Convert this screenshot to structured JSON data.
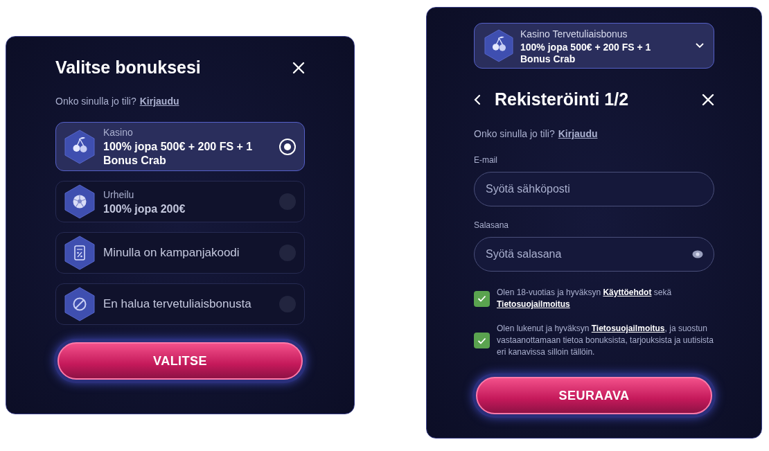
{
  "bonus_picker": {
    "title": "Valitse bonuksesi",
    "login_prompt": "Onko sinulla jo tili?",
    "login_link": "Kirjaudu",
    "options": [
      {
        "kind": "cherry",
        "category": "Kasino",
        "title": "100% jopa 500€ + 200 FS + 1 Bonus Crab",
        "selected": true
      },
      {
        "kind": "ball",
        "category": "Urheilu",
        "title": "100% jopa 200€",
        "selected": false
      },
      {
        "kind": "coupon",
        "title": "Minulla on kampanjakoodi",
        "selected": false
      },
      {
        "kind": "none",
        "title": "En halua tervetuliaisbonusta",
        "selected": false
      }
    ],
    "button": "VALITSE"
  },
  "registration": {
    "bonus_select": {
      "label": "Kasino Tervetuliaisbonus",
      "value": "100% jopa 500€ + 200 FS + 1 Bonus Crab"
    },
    "title": "Rekisteröinti 1/2",
    "login_prompt": "Onko sinulla jo tili?",
    "login_link": "Kirjaudu",
    "fields": [
      {
        "kind": "email",
        "label": "E-mail",
        "placeholder": "Syötä sähköposti"
      },
      {
        "kind": "password",
        "label": "Salasana",
        "placeholder": "Syötä salasana"
      }
    ],
    "consents": [
      {
        "checked": true,
        "parts": [
          {
            "kind": "text",
            "text": "Olen 18-vuotias ja hyväksyn"
          },
          {
            "kind": "link",
            "text": "Käyttöehdot"
          },
          {
            "kind": "text",
            "text": "sekä"
          },
          {
            "kind": "link",
            "text": "Tietosuojailmoitus"
          }
        ]
      },
      {
        "checked": true,
        "parts": [
          {
            "kind": "text",
            "text": "Olen lukenut ja hyväksyn"
          },
          {
            "kind": "link",
            "text": "Tietosuojailmoitus"
          },
          {
            "kind": "text",
            "text": ", ja suostun vastaanottamaan tietoa bonuksista, tarjouksista ja uutisista eri kanavissa silloin tällöin."
          }
        ]
      }
    ],
    "button": "SEURAAVA"
  }
}
